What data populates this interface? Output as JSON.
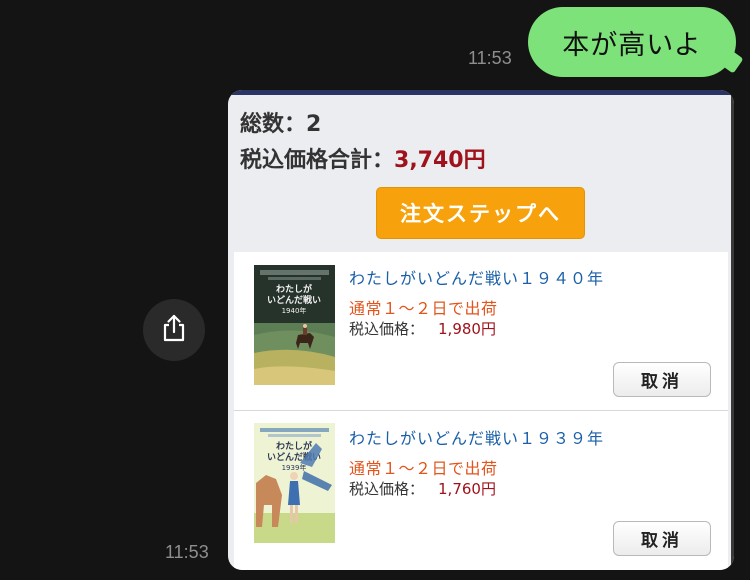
{
  "chat": {
    "message_text": "本が高いよ",
    "sent_time": "11:53",
    "card_time": "11:53"
  },
  "share_button": {
    "icon": "share-icon"
  },
  "cart": {
    "count_label": "総数：",
    "count_value": "2",
    "total_label": "税込価格合計：",
    "total_value": "3,740円",
    "checkout_label": "注文ステップへ",
    "items": [
      {
        "title": "わたしがいどんだ戦い１９４０年",
        "shipping": "通常１～２日で出荷",
        "price_label": "税込価格：",
        "price": "1,980円",
        "cancel_label": "取消",
        "cover_alt": "book-cover"
      },
      {
        "title": "わたしがいどんだ戦い１９３９年",
        "shipping": "通常１～２日で出荷",
        "price_label": "税込価格：",
        "price": "1,760円",
        "cancel_label": "取消",
        "cover_alt": "book-cover"
      }
    ]
  },
  "colors": {
    "background": "#141414",
    "bubble": "#7ee27a",
    "accent_price": "#a0121b",
    "checkout": "#f7a20c",
    "title_link": "#1a5fa8",
    "shipping": "#e0561d"
  }
}
